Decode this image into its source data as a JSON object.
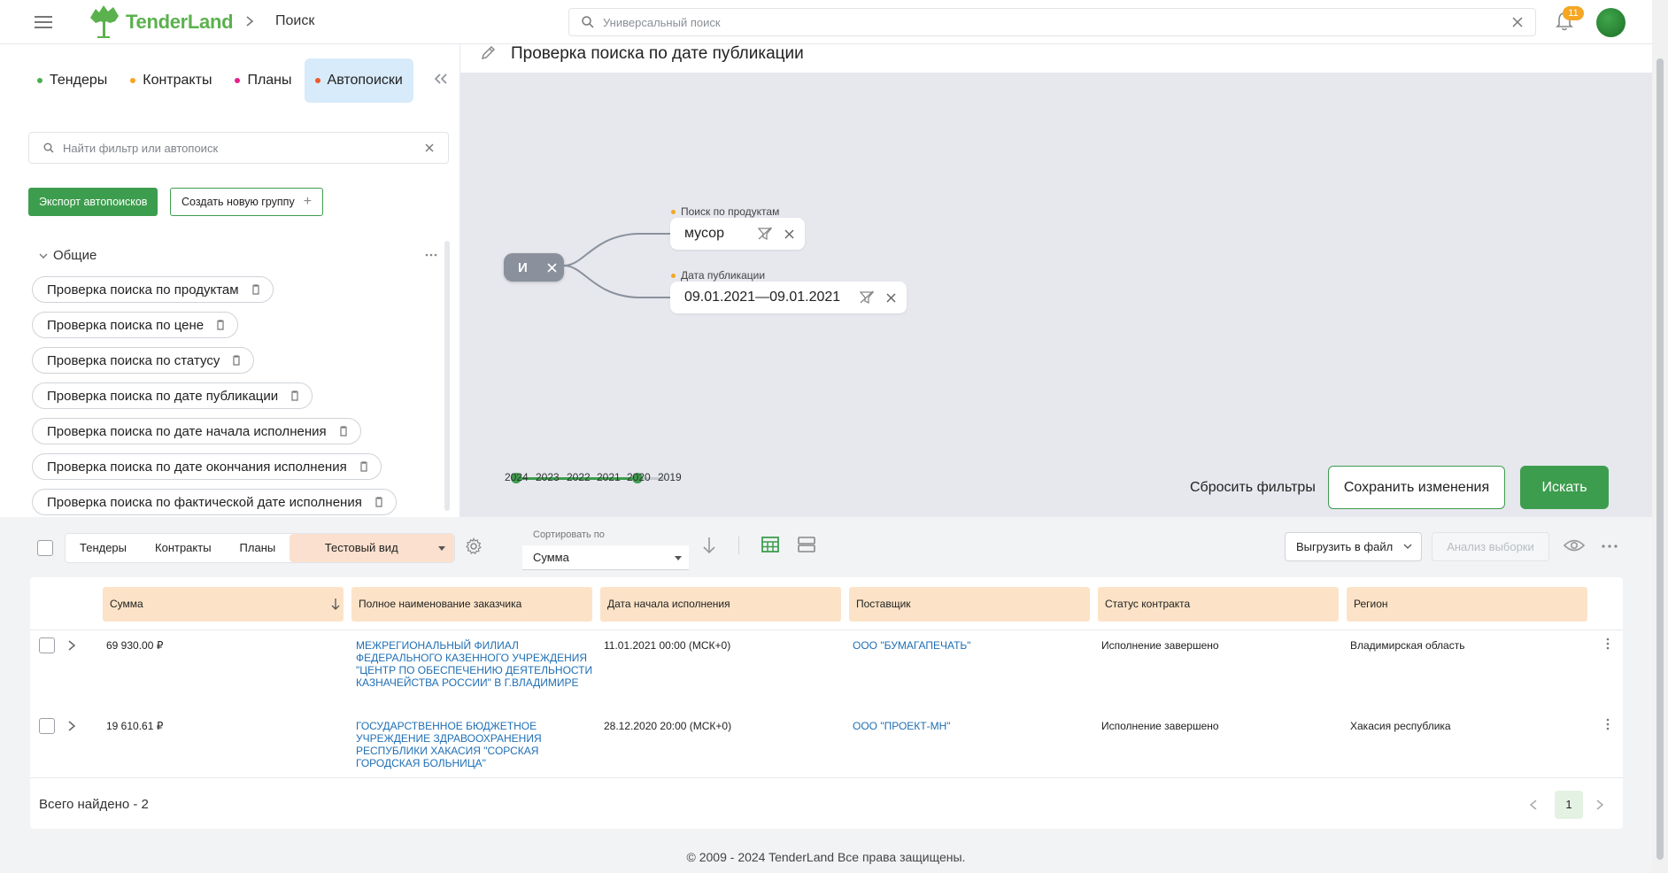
{
  "header": {
    "logo_text": "TenderLand",
    "breadcrumb": "Поиск",
    "search_placeholder": "Универсальный поиск",
    "notifications_count": "11"
  },
  "left": {
    "tabs": [
      {
        "label": "Тендеры",
        "color": "#4caf50"
      },
      {
        "label": "Контракты",
        "color": "#f5a623"
      },
      {
        "label": "Планы",
        "color": "#e91e8c"
      },
      {
        "label": "Автопоиски",
        "color": "#f05a28"
      }
    ],
    "filter_search_placeholder": "Найти фильтр или автопоиск",
    "export_label": "Экспорт автопоисков",
    "new_group_label": "Создать новую группу",
    "group_name": "Общие",
    "filters": [
      "Проверка поиска по продуктам",
      "Проверка поиска по цене",
      "Проверка поиска по статусу",
      "Проверка поиска по дате публикации",
      "Проверка поиска по дате начала исполнения",
      "Проверка поиска по дате окончания исполнения",
      "Проверка поиска по фактической дате исполнения"
    ]
  },
  "editor": {
    "title": "Проверка поиска по дате публикации",
    "operator": "И",
    "conditions": [
      {
        "label": "Поиск по продуктам",
        "value": "мусор"
      },
      {
        "label": "Дата публикации",
        "value": "09.01.2021—09.01.2021"
      }
    ],
    "years": [
      "2024",
      "2023",
      "2022",
      "2021",
      "2020",
      "2019"
    ],
    "year_range": [
      "2024",
      "2020"
    ],
    "reset_label": "Сбросить фильтры",
    "save_label": "Сохранить изменения",
    "search_label": "Искать"
  },
  "toolbar": {
    "view_tabs": [
      "Тендеры",
      "Контракты",
      "Планы"
    ],
    "selected_view": "Тестовый вид",
    "sort_label": "Сортировать по",
    "sort_value": "Сумма",
    "export_file_label": "Выгрузить в файл",
    "analyze_label": "Анализ выборки"
  },
  "table": {
    "columns": [
      "Сумма",
      "Полное наименование заказчика",
      "Дата начала исполнения",
      "Поставщик",
      "Статус контракта",
      "Регион"
    ],
    "rows": [
      {
        "sum": "69 930.00 ₽",
        "customer": "МЕЖРЕГИОНАЛЬНЫЙ ФИЛИАЛ ФЕДЕРАЛЬНОГО КАЗЕННОГО УЧРЕЖДЕНИЯ \"ЦЕНТР ПО ОБЕСПЕЧЕНИЮ ДЕЯТЕЛЬНОСТИ КАЗНАЧЕЙСТВА РОССИИ\" В Г.ВЛАДИМИРЕ",
        "start_date": "11.01.2021 00:00 (МСК+0)",
        "supplier": "ООО \"БУМАГАПЕЧАТЬ\"",
        "status": "Исполнение завершено",
        "region": "Владимирская область"
      },
      {
        "sum": "19 610.61 ₽",
        "customer": "ГОСУДАРСТВЕННОЕ БЮДЖЕТНОЕ УЧРЕЖДЕНИЕ ЗДРАВООХРАНЕНИЯ РЕСПУБЛИКИ ХАКАСИЯ \"СОРСКАЯ ГОРОДСКАЯ БОЛЬНИЦА\"",
        "start_date": "28.12.2020 20:00 (МСК+0)",
        "supplier": "ООО \"ПРОЕКТ-МН\"",
        "status": "Исполнение завершено",
        "region": "Хакасия республика"
      }
    ],
    "total": "Всего найдено - 2",
    "current_page": "1"
  },
  "footer": "© 2009 - 2024 TenderLand Все права защищены.",
  "colors": {
    "accent": "#3d9d4e",
    "link": "#1f6fb5",
    "header_cell": "#fce3c7"
  }
}
